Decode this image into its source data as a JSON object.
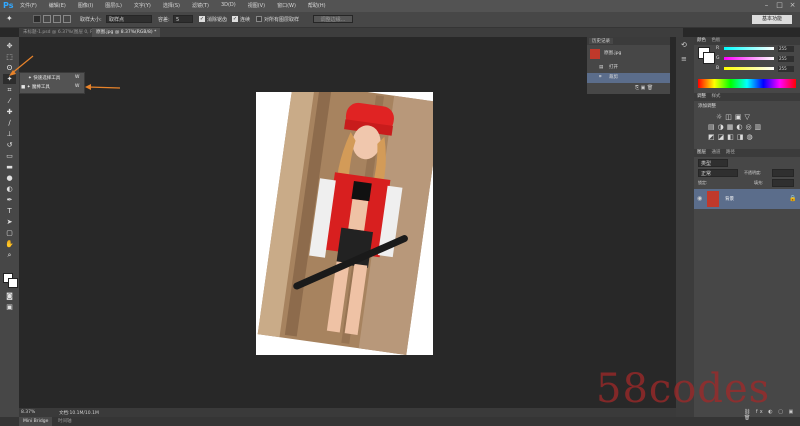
{
  "app": {
    "logo": "Ps"
  },
  "menu": [
    "文件(F)",
    "编辑(E)",
    "图像(I)",
    "图层(L)",
    "文字(Y)",
    "选择(S)",
    "滤镜(T)",
    "3D(D)",
    "视图(V)",
    "窗口(W)",
    "帮助(H)"
  ],
  "window_controls": {
    "minimize": "–",
    "maximize": "□",
    "close": "×"
  },
  "options": {
    "sample_size_label": "取样大小:",
    "sample_size_value": "取样点",
    "tolerance_label": "容差:",
    "tolerance_value": "5",
    "antialias_label": "消除锯齿",
    "contiguous_label": "连续",
    "all_layers_label": "对所有图层取样",
    "refine_edge_button": "调整边缘...",
    "workspace_select": "基本功能"
  },
  "tabs": [
    {
      "label": "未标题-1.psd @ 6.37%(图层 0, RGB/8)"
    },
    {
      "label": "原图.jpg @ 8.37%(RGB/8) *"
    }
  ],
  "flyout": [
    {
      "label": "快速选择工具",
      "shortcut": "W"
    },
    {
      "label": "魔棒工具",
      "shortcut": "W"
    }
  ],
  "status": {
    "zoom": "8.37%",
    "doc_info": "文档:10.1M/10.1M"
  },
  "bottom_tabs": [
    "Mini Bridge",
    "时间轴"
  ],
  "history": {
    "tabs": [
      "历史记录"
    ],
    "snapshot": "原图.jpg",
    "rows": [
      "打开",
      "裁剪"
    ]
  },
  "color_panel": {
    "tabs": [
      "颜色",
      "色板"
    ],
    "rows": [
      {
        "label": "R",
        "value": "255"
      },
      {
        "label": "G",
        "value": "255"
      },
      {
        "label": "B",
        "value": "255"
      }
    ]
  },
  "adjust_panel": {
    "tabs": [
      "调整",
      "样式"
    ],
    "title": "添加调整"
  },
  "layers_panel": {
    "tabs": [
      "图层",
      "通道",
      "路径"
    ],
    "kind_label": "类型",
    "blend_mode": "正常",
    "opacity_label": "不透明度:",
    "lock_label": "锁定:",
    "fill_label": "填充:",
    "layer_name": "背景"
  },
  "watermark": "58codes",
  "colors": {
    "accent": "#31a8ff",
    "selected_layer": "#5b6d8b",
    "arrow": "#e8832a"
  }
}
